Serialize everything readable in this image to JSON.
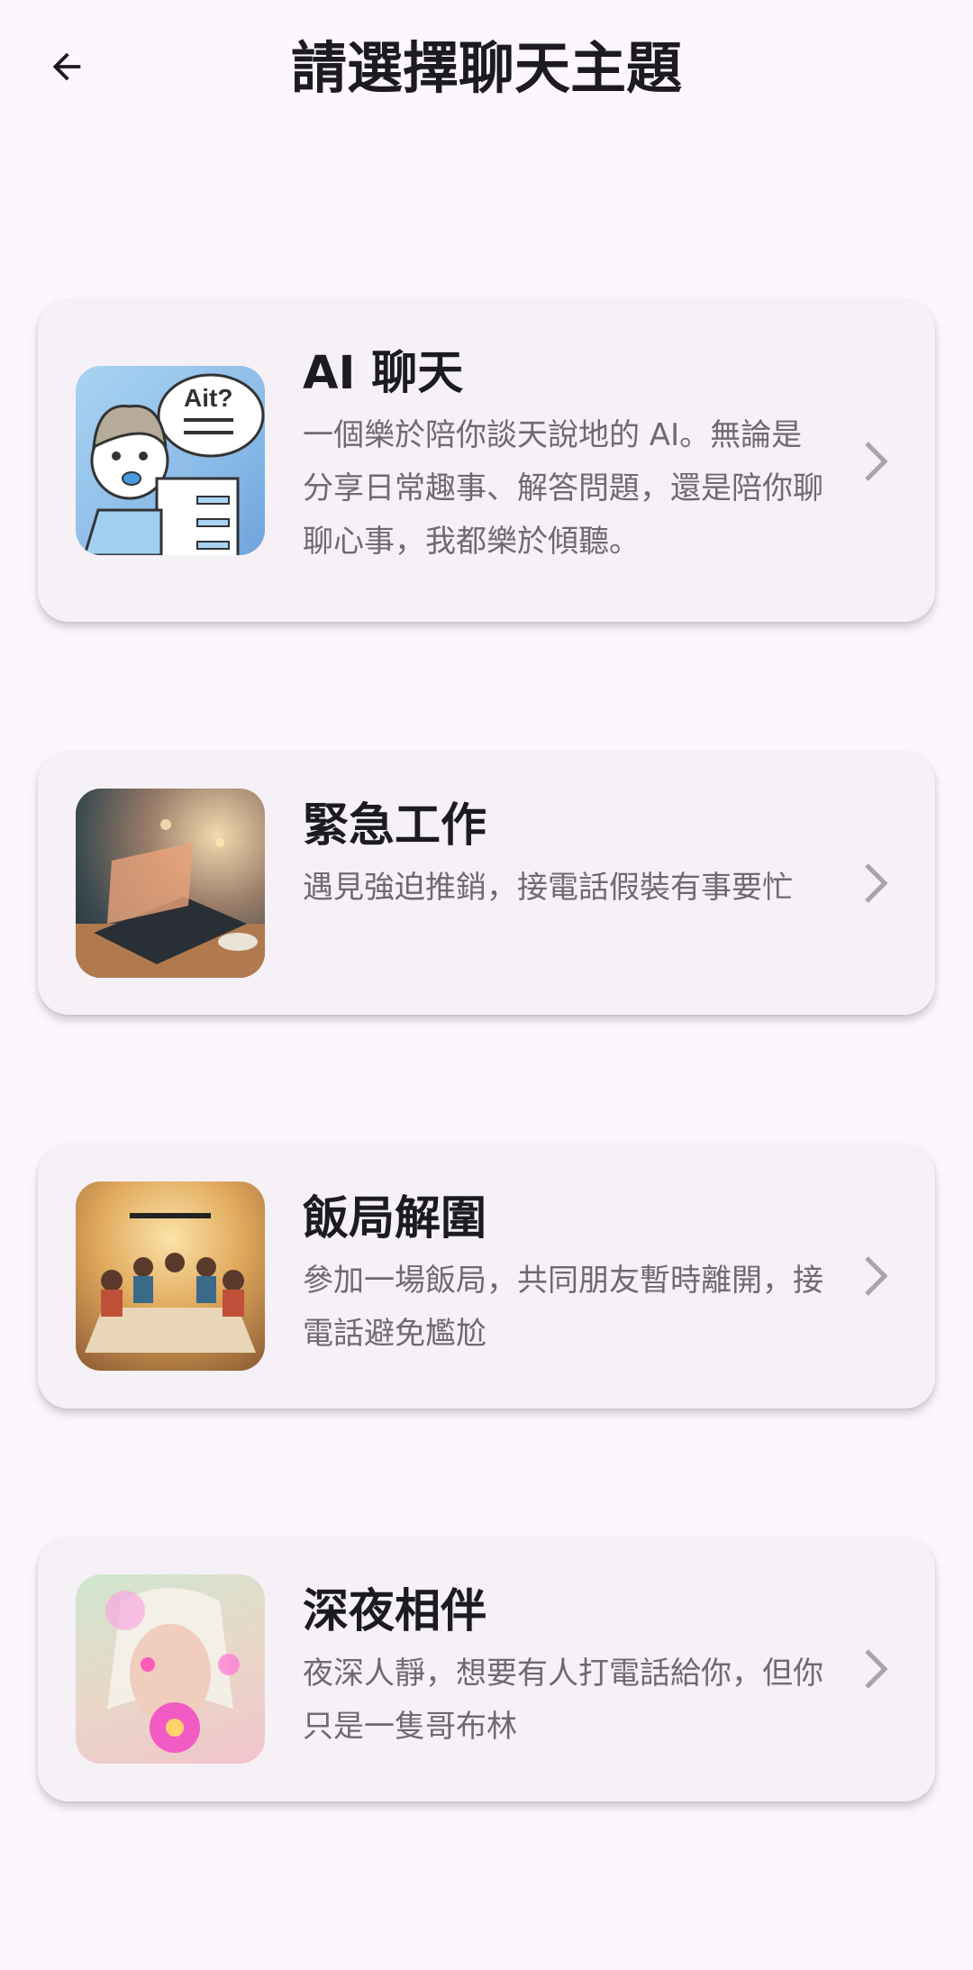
{
  "header": {
    "title": "請選擇聊天主題",
    "back_icon": "arrow-back-icon"
  },
  "topics": [
    {
      "title": "AI 聊天",
      "description": "一個樂於陪你談天說地的 AI。無論是分享日常趣事、解答問題，還是陪你聊聊心事，我都樂於傾聽。"
    },
    {
      "title": "緊急工作",
      "description": "遇見強迫推銷，接電話假裝有事要忙"
    },
    {
      "title": "飯局解圍",
      "description": "參加一場飯局，共同朋友暫時離開，接電話避免尷尬"
    },
    {
      "title": "深夜相伴",
      "description": "夜深人靜，想要有人打電話給你，但你只是一隻哥布林"
    }
  ]
}
